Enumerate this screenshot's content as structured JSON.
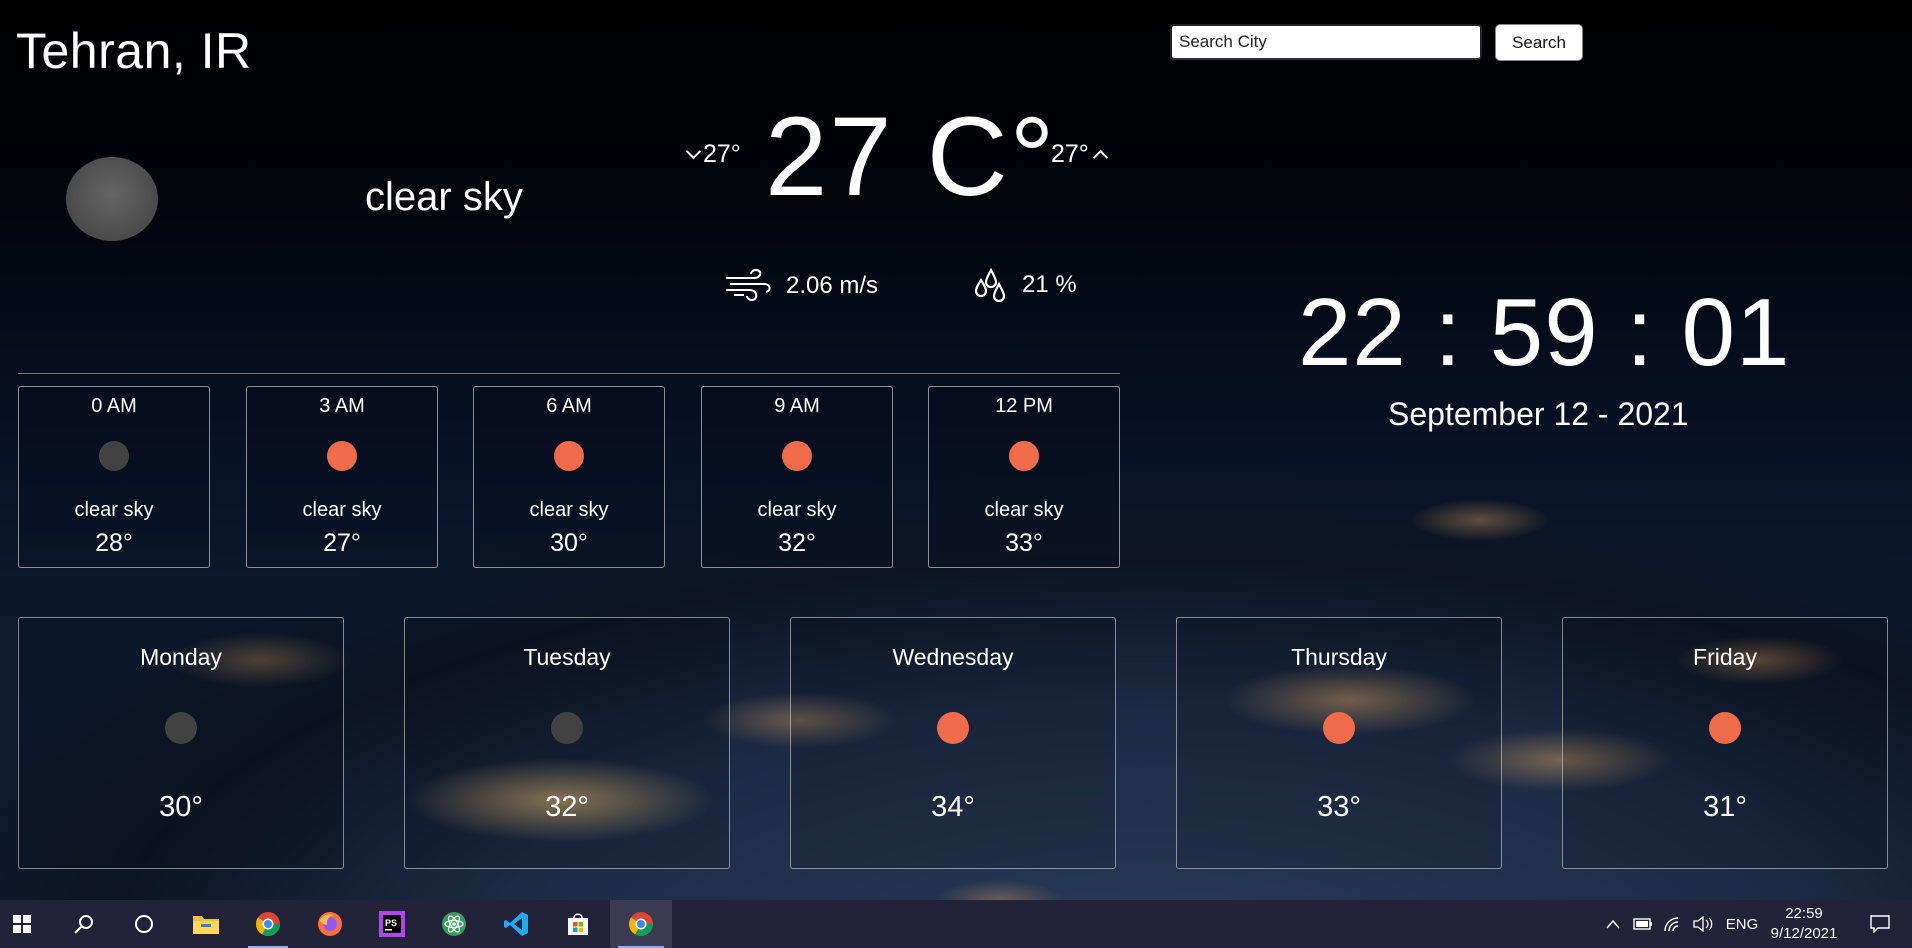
{
  "location": "Tehran, IR",
  "current": {
    "icon": "moon-icon",
    "description": "clear sky",
    "temp": "27 C°",
    "temp_min": "27°",
    "temp_max": "27°",
    "wind": "2.06 m/s",
    "humidity": "21 %"
  },
  "search": {
    "placeholder": "Search City",
    "button": "Search"
  },
  "clock": {
    "time": "22 : 59 : 01",
    "date": "September 12 - 2021"
  },
  "hourly": [
    {
      "time": "0 AM",
      "icon": "moon-icon",
      "desc": "clear sky",
      "temp": "28°"
    },
    {
      "time": "3 AM",
      "icon": "sun-icon",
      "desc": "clear sky",
      "temp": "27°"
    },
    {
      "time": "6 AM",
      "icon": "sun-icon",
      "desc": "clear sky",
      "temp": "30°"
    },
    {
      "time": "9 AM",
      "icon": "sun-icon",
      "desc": "clear sky",
      "temp": "32°"
    },
    {
      "time": "12 PM",
      "icon": "sun-icon",
      "desc": "clear sky",
      "temp": "33°"
    }
  ],
  "daily": [
    {
      "day": "Monday",
      "icon": "moon-icon",
      "temp": "30°"
    },
    {
      "day": "Tuesday",
      "icon": "moon-icon",
      "temp": "32°"
    },
    {
      "day": "Wednesday",
      "icon": "sun-icon",
      "temp": "34°"
    },
    {
      "day": "Thursday",
      "icon": "sun-icon",
      "temp": "33°"
    },
    {
      "day": "Friday",
      "icon": "sun-icon",
      "temp": "31°"
    }
  ],
  "colors": {
    "sun": "#ef6b4a",
    "moon": "#424242",
    "taskbar": "#222238"
  },
  "taskbar": {
    "apps": [
      "windows-start-icon",
      "search-icon",
      "cortana-icon",
      "file-explorer-icon",
      "chrome-icon",
      "firefox-icon",
      "phpstorm-icon",
      "atom-icon",
      "vscode-icon",
      "store-icon",
      "chrome-icon"
    ],
    "language": "ENG",
    "time": "22:59",
    "date": "9/12/2021"
  }
}
